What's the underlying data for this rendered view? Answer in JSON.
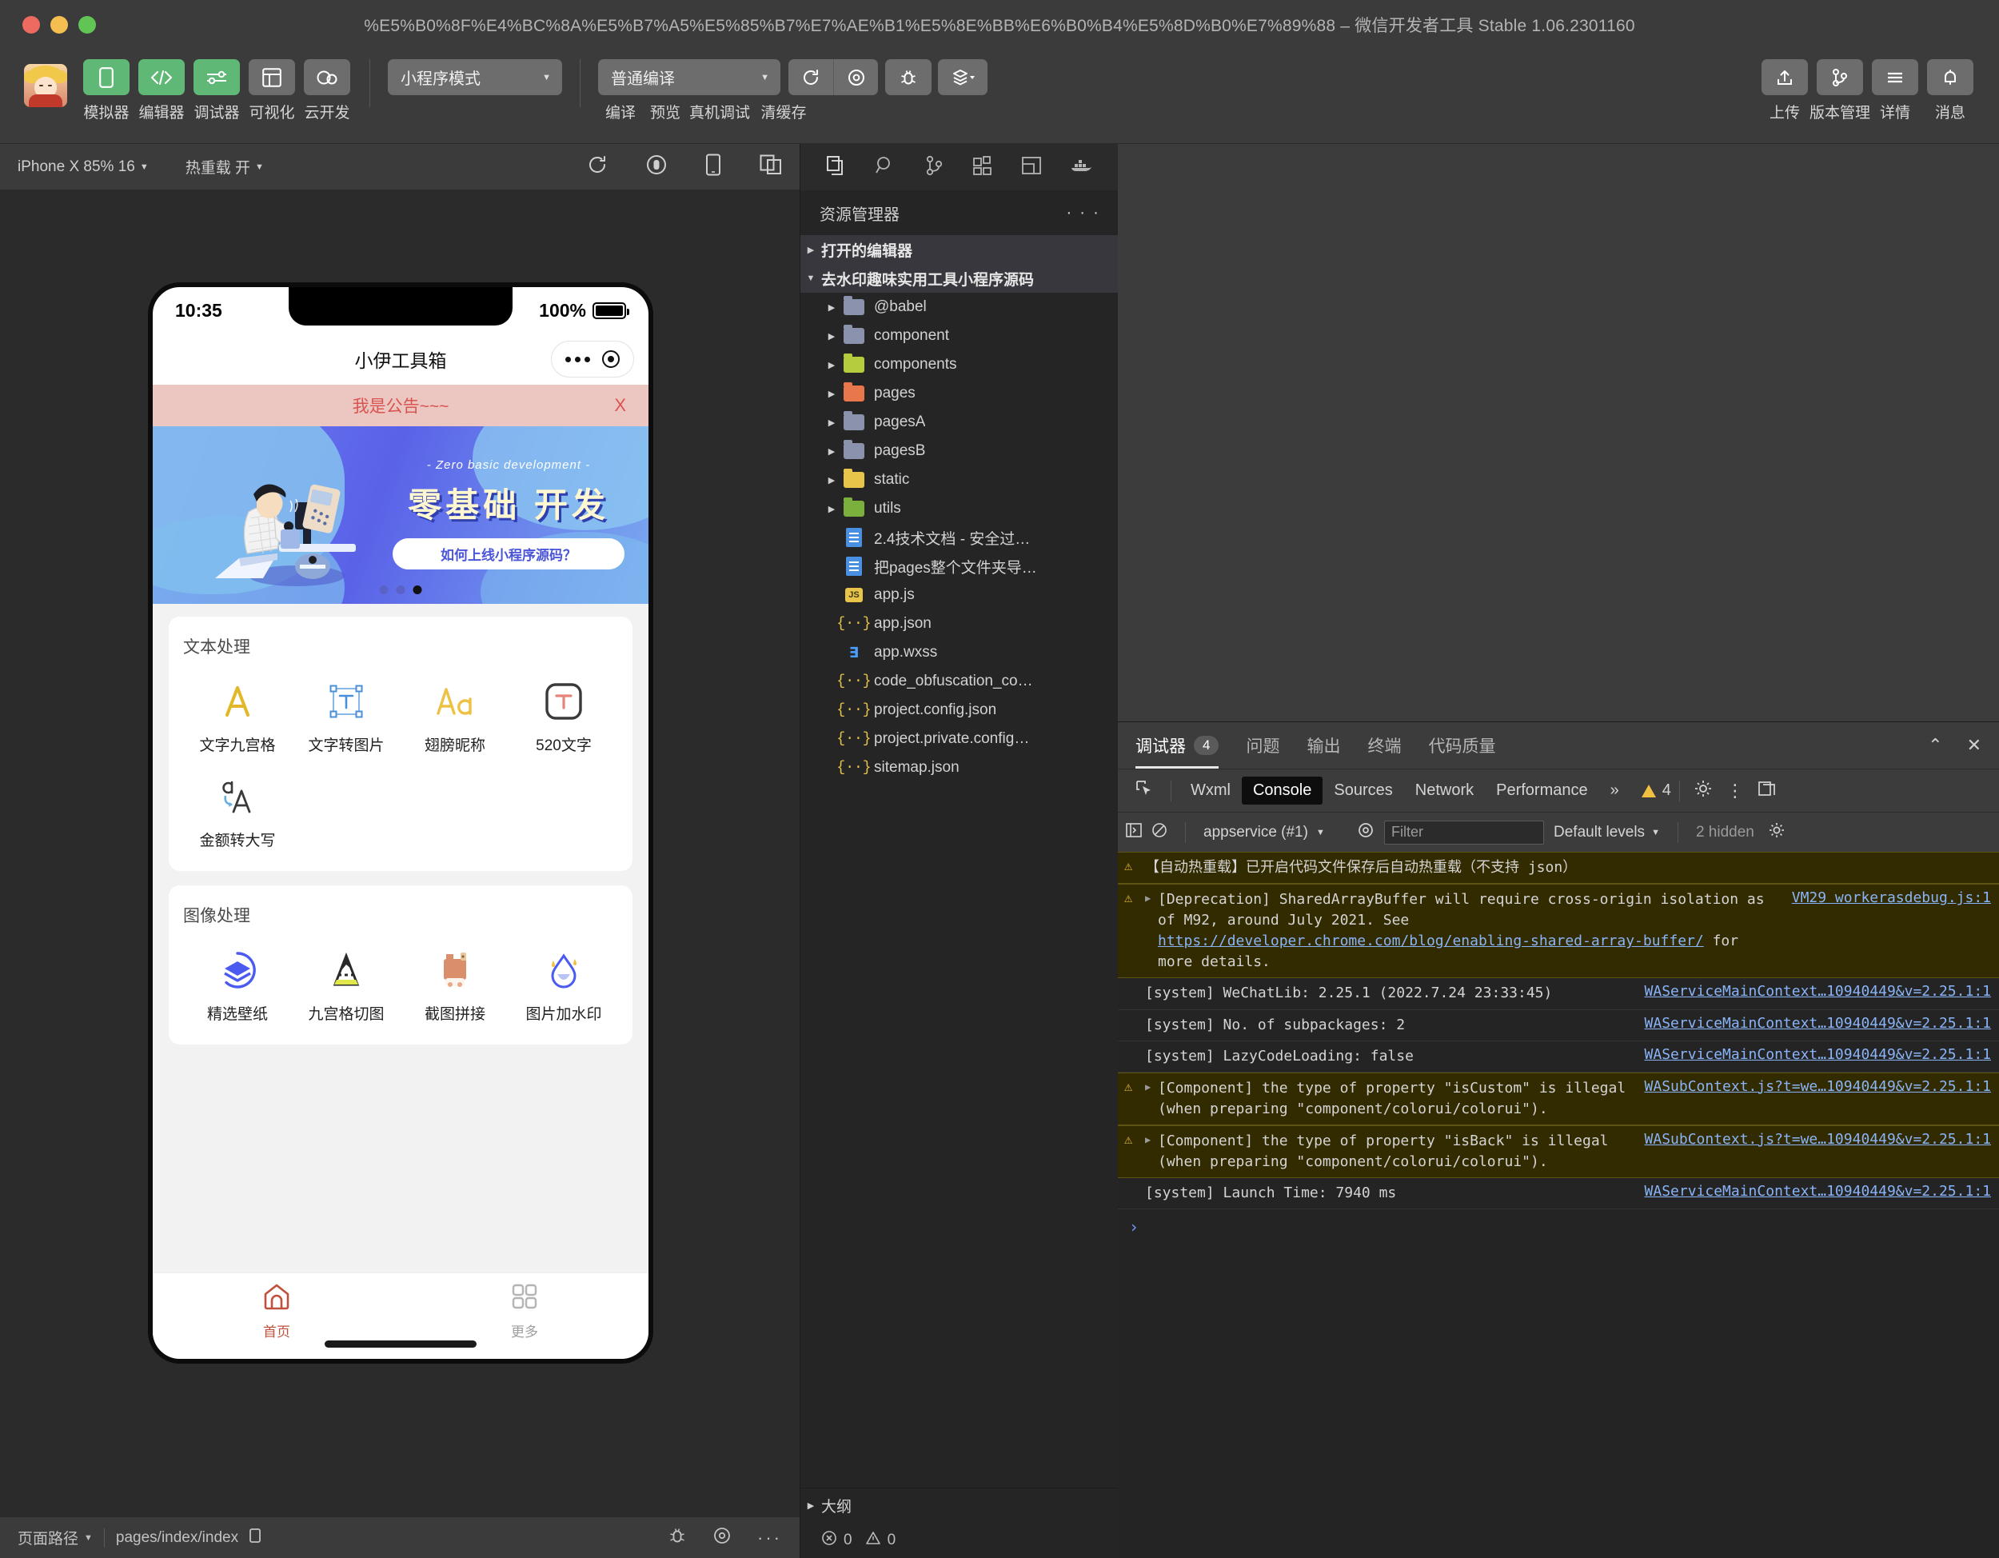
{
  "window": {
    "title": "%E5%B0%8F%E4%BC%8A%E5%B7%A5%E5%85%B7%E7%AE%B1%E5%8E%BB%E6%B0%B4%E5%8D%B0%E7%89%88 – 微信开发者工具 Stable 1.06.2301160"
  },
  "toolbar": {
    "buttons": [
      {
        "label": "模拟器",
        "icon": "phone-icon",
        "active": true
      },
      {
        "label": "编辑器",
        "icon": "code-icon",
        "active": true
      },
      {
        "label": "调试器",
        "icon": "sliders-icon",
        "active": true
      },
      {
        "label": "可视化",
        "icon": "layout-icon",
        "active": false
      },
      {
        "label": "云开发",
        "icon": "cloud-icon",
        "active": false
      }
    ],
    "mode_select": "小程序模式",
    "compile_select": "普通编译",
    "actions": [
      {
        "label": "编译",
        "icon": "refresh-icon"
      },
      {
        "label": "预览",
        "icon": "preview-eye-icon"
      },
      {
        "label": "真机调试",
        "icon": "bug-icon"
      },
      {
        "label": "清缓存",
        "icon": "layers-icon"
      }
    ],
    "right_actions": [
      {
        "label": "上传",
        "icon": "upload-icon"
      },
      {
        "label": "版本管理",
        "icon": "git-branch-icon"
      },
      {
        "label": "详情",
        "icon": "hamburger-icon"
      },
      {
        "label": "消息",
        "icon": "bell-icon"
      }
    ]
  },
  "simulator": {
    "device": "iPhone X 85% 16",
    "hot_reload": "热重载 开",
    "icons": [
      "rotate-icon",
      "record-icon",
      "device-icon",
      "multi-window-icon"
    ],
    "status": {
      "page_path_label": "页面路径",
      "page_path_value": "pages/index/index",
      "copy_icon": "copy-icon",
      "icons": [
        "bug-icon",
        "eye-icon",
        "more-icon"
      ]
    },
    "phone": {
      "time": "10:35",
      "battery_percent": "100%",
      "nav_title": "小伊工具箱",
      "notice_text": "我是公告~~~",
      "notice_close": "X",
      "banner": {
        "english": "- Zero basic development -",
        "chinese": "零基础 开发",
        "button": "如何上线小程序源码？",
        "dots": 3,
        "active_dot": 3
      },
      "sections": [
        {
          "title": "文本处理",
          "items": [
            {
              "label": "文字九宫格",
              "icon": "letter-a-yellow-icon"
            },
            {
              "label": "文字转图片",
              "icon": "text-box-icon"
            },
            {
              "label": "翅膀昵称",
              "icon": "aa-font-icon"
            },
            {
              "label": "520文字",
              "icon": "t-rounded-icon"
            },
            {
              "label": "金额转大写",
              "icon": "case-convert-icon"
            }
          ]
        },
        {
          "title": "图像处理",
          "items": [
            {
              "label": "精选壁纸",
              "icon": "layers-circle-icon"
            },
            {
              "label": "九宫格切图",
              "icon": "mountain-icon"
            },
            {
              "label": "截图拼接",
              "icon": "stitch-icon"
            },
            {
              "label": "图片加水印",
              "icon": "water-drop-icon"
            }
          ]
        }
      ],
      "tabbar": [
        {
          "label": "首页",
          "icon": "home-icon",
          "active": true
        },
        {
          "label": "更多",
          "icon": "grid-icon",
          "active": false
        }
      ]
    }
  },
  "explorer": {
    "sidebar_icons": [
      "files-icon",
      "search-icon",
      "source-control-icon",
      "extensions-icon",
      "layout-panel-icon",
      "docker-icon"
    ],
    "header": "资源管理器",
    "more": "· · ·",
    "sections": [
      {
        "label": "打开的编辑器",
        "expanded": false
      },
      {
        "label": "去水印趣味实用工具小程序源码",
        "expanded": true
      }
    ],
    "files": [
      {
        "name": "@babel",
        "type": "folder",
        "color": "grey",
        "expandable": true
      },
      {
        "name": "component",
        "type": "folder",
        "color": "grey",
        "expandable": true
      },
      {
        "name": "components",
        "type": "folder",
        "color": "green",
        "expandable": true
      },
      {
        "name": "pages",
        "type": "folder",
        "color": "orange",
        "expandable": true
      },
      {
        "name": "pagesA",
        "type": "folder",
        "color": "grey",
        "expandable": true
      },
      {
        "name": "pagesB",
        "type": "folder",
        "color": "grey",
        "expandable": true
      },
      {
        "name": "static",
        "type": "folder",
        "color": "yellow",
        "expandable": true
      },
      {
        "name": "utils",
        "type": "folder",
        "color": "green2",
        "expandable": true
      },
      {
        "name": "2.4技术文档 - 安全过…",
        "type": "doc",
        "expandable": false
      },
      {
        "name": "把pages整个文件夹导…",
        "type": "doc",
        "expandable": false
      },
      {
        "name": "app.js",
        "type": "js",
        "expandable": false
      },
      {
        "name": "app.json",
        "type": "json",
        "expandable": false
      },
      {
        "name": "app.wxss",
        "type": "wxss",
        "expandable": false
      },
      {
        "name": "code_obfuscation_co…",
        "type": "json",
        "expandable": false
      },
      {
        "name": "project.config.json",
        "type": "json",
        "expandable": false
      },
      {
        "name": "project.private.config…",
        "type": "json",
        "expandable": false
      },
      {
        "name": "sitemap.json",
        "type": "json",
        "expandable": false
      }
    ],
    "outline": "大纲",
    "status": {
      "errors": "0",
      "warnings": "0"
    }
  },
  "devtools": {
    "tabs": [
      {
        "label": "调试器",
        "badge": "4",
        "active": true
      },
      {
        "label": "问题",
        "badge": "",
        "active": false
      },
      {
        "label": "输出",
        "badge": "",
        "active": false
      },
      {
        "label": "终端",
        "badge": "",
        "active": false
      },
      {
        "label": "代码质量",
        "badge": "",
        "active": false
      }
    ],
    "window_actions": [
      "collapse-icon",
      "close-icon"
    ],
    "panels": [
      {
        "label": "Wxml",
        "active": false
      },
      {
        "label": "Console",
        "active": true
      },
      {
        "label": "Sources",
        "active": false
      },
      {
        "label": "Network",
        "active": false
      },
      {
        "label": "Performance",
        "active": false
      }
    ],
    "overflow": "»",
    "warning_count": "4",
    "panel_icons": [
      "settings-gear-icon",
      "kebab-menu-icon",
      "dock-icon"
    ],
    "filter_bar": {
      "sidebar_icon": "console-sidebar-icon",
      "clear_icon": "clear-console-icon",
      "context": "appservice (#1)",
      "eye_icon": "live-expression-icon",
      "filter_placeholder": "Filter",
      "levels": "Default levels",
      "hidden": "2 hidden",
      "settings_icon": "console-settings-icon"
    },
    "messages": [
      {
        "level": "warn",
        "expandable": false,
        "text": "【自动热重载】已开启代码文件保存后自动热重载（不支持 json）",
        "source": ""
      },
      {
        "level": "warn",
        "expandable": true,
        "text": "[Deprecation] SharedArrayBuffer will require cross-origin isolation as of M92, around July 2021. See https://developer.chrome.com/blog/enabling-shared-array-buffer/ for more details.",
        "source": "VM29 workerasdebug.js:1"
      },
      {
        "level": "info",
        "expandable": false,
        "text": "[system] WeChatLib: 2.25.1 (2022.7.24 23:33:45)",
        "source": "WAServiceMainContext…10940449&v=2.25.1:1"
      },
      {
        "level": "info",
        "expandable": false,
        "text": "[system] No. of subpackages: 2",
        "source": "WAServiceMainContext…10940449&v=2.25.1:1"
      },
      {
        "level": "info",
        "expandable": false,
        "text": "[system] LazyCodeLoading: false",
        "source": "WAServiceMainContext…10940449&v=2.25.1:1"
      },
      {
        "level": "warn",
        "expandable": true,
        "text": "[Component] the type of property \"isCustom\" is illegal (when preparing \"component/colorui/colorui\").",
        "source": "WASubContext.js?t=we…10940449&v=2.25.1:1"
      },
      {
        "level": "warn",
        "expandable": true,
        "text": "[Component] the type of property \"isBack\" is illegal (when preparing \"component/colorui/colorui\").",
        "source": "WASubContext.js?t=we…10940449&v=2.25.1:1"
      },
      {
        "level": "info",
        "expandable": false,
        "text": "[system] Launch Time: 7940 ms",
        "source": "WAServiceMainContext…10940449&v=2.25.1:1"
      }
    ],
    "prompt": "›"
  },
  "colors": {
    "accent_green": "#60b877",
    "warn_bg": "#332b00",
    "link": "#8ab4f8",
    "notice_bg": "#ecc7c2",
    "notice_text": "#d9534f",
    "tab_active": "#c0503c"
  }
}
